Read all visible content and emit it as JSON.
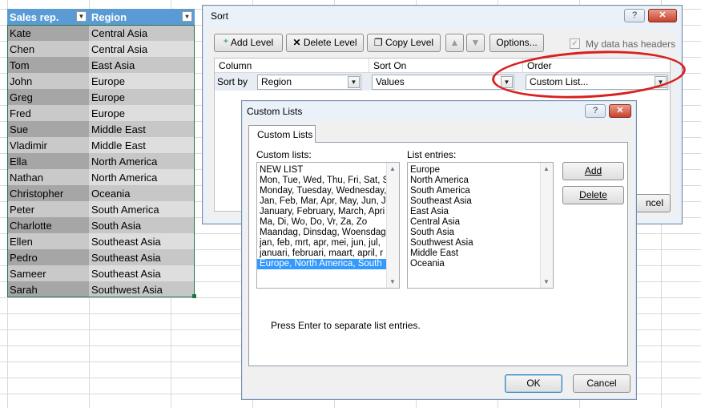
{
  "sheet": {
    "headers": [
      "Sales rep.",
      "Region"
    ],
    "rows": [
      [
        "Kate",
        "Central Asia"
      ],
      [
        "Chen",
        "Central Asia"
      ],
      [
        "Tom",
        "East Asia"
      ],
      [
        "John",
        "Europe"
      ],
      [
        "Greg",
        "Europe"
      ],
      [
        "Fred",
        "Europe"
      ],
      [
        "Sue",
        "Middle East"
      ],
      [
        "Vladimir",
        "Middle East"
      ],
      [
        "Ella",
        "North America"
      ],
      [
        "Nathan",
        "North America"
      ],
      [
        "Christopher",
        "Oceania"
      ],
      [
        "Peter",
        "South America"
      ],
      [
        "Charlotte",
        "South Asia"
      ],
      [
        "Ellen",
        "Southeast Asia"
      ],
      [
        "Pedro",
        "Southeast Asia"
      ],
      [
        "Sameer",
        "Southeast Asia"
      ],
      [
        "Sarah",
        "Southwest Asia"
      ]
    ]
  },
  "sort_dialog": {
    "title": "Sort",
    "help": "?",
    "close": "✕",
    "add_level": "Add Level",
    "delete_level": "Delete Level",
    "copy_level": "Copy Level",
    "options": "Options...",
    "my_data_has_headers": "My data has headers",
    "col_column": "Column",
    "col_sort_on": "Sort On",
    "col_order": "Order",
    "sort_by": "Sort by",
    "column_value": "Region",
    "sort_on_value": "Values",
    "order_value": "Custom List...",
    "cancel_partial": "ncel"
  },
  "custom_lists_dialog": {
    "title": "Custom Lists",
    "help": "?",
    "close": "✕",
    "tab": "Custom Lists",
    "custom_lists_label": "Custom lists:",
    "list_entries_label": "List entries:",
    "lists": [
      "NEW LIST",
      "Mon, Tue, Wed, Thu, Fri, Sat, S",
      "Monday, Tuesday, Wednesday,",
      "Jan, Feb, Mar, Apr, May, Jun, Ju",
      "January, February, March, Apri",
      "Ma, Di, Wo, Do, Vr, Za, Zo",
      "Maandag, Dinsdag, Woensdag",
      "jan, feb, mrt, apr, mei, jun, jul,",
      "januari, februari, maart, april, r",
      "Europe, North America, South"
    ],
    "selected_index": 9,
    "entries": [
      "Europe",
      "North America",
      "South America",
      "Southeast Asia",
      "East Asia",
      "Central Asia",
      "South Asia",
      "Southwest Asia",
      "Middle East",
      "Oceania"
    ],
    "add": "Add",
    "delete": "Delete",
    "hint": "Press Enter to separate list entries.",
    "ok": "OK",
    "cancel": "Cancel"
  },
  "colors": {
    "table_header": "#5b9bd5",
    "selection_outline": "#217346",
    "annotation": "#d9201f"
  }
}
